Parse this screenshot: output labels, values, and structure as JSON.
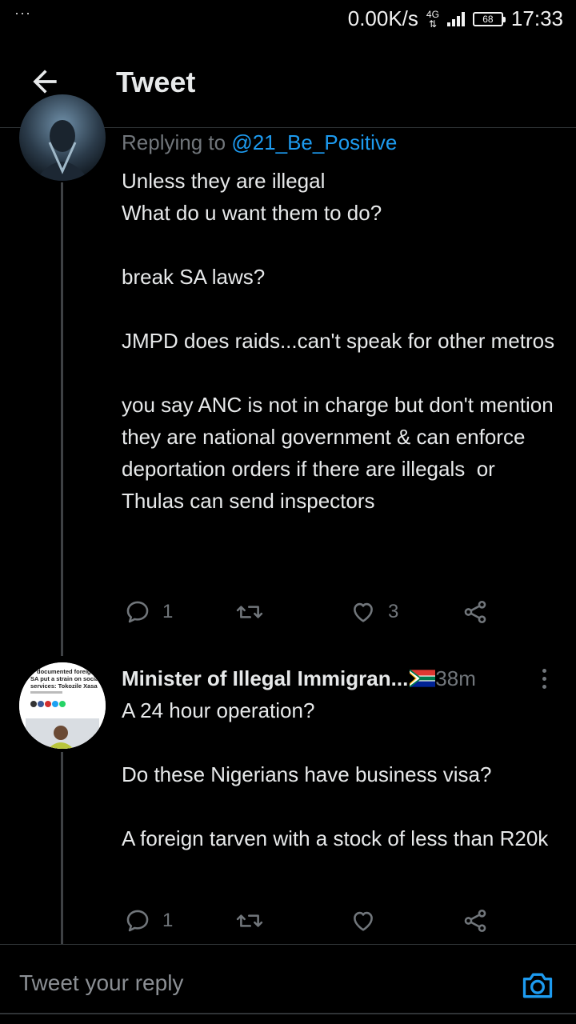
{
  "status_bar": {
    "dots": "···",
    "speed": "0.00K/s",
    "network": "4G",
    "battery": "68",
    "time": "17:33"
  },
  "header": {
    "back_icon": "arrow-left-icon",
    "title": "Tweet"
  },
  "tweet1": {
    "reply_prefix": "Replying to ",
    "reply_handle": "@21_Be_Positive",
    "text": "Unless they are illegal\nWhat do u want them to do?\n\nbreak SA laws?\n\nJMPD does raids...can't speak for other metros\n\nyou say ANC is not in charge but don't mention they are national government & can enforce deportation orders if there are illegals  or Thulas can send inspectors",
    "replies": "1",
    "retweets": "",
    "likes": "3"
  },
  "tweet2": {
    "display_name": "Minister of Illegal Immigran...",
    "time": "38m",
    "text": "A 24 hour operation?\n\nDo these Nigerians have business visa?\n\nA foreign tarven with a stock of less than R20k",
    "replies": "1",
    "retweets": "",
    "likes": "",
    "avatar_text": {
      "line1": "documented foreign",
      "line2": "SA put a strain on social",
      "line3": "services: Tokozile Xasa"
    }
  },
  "composer": {
    "placeholder": "Tweet your reply",
    "camera_icon": "camera-icon"
  },
  "colors": {
    "background": "#000000",
    "accent": "#1d9bf0",
    "muted": "#71767b",
    "text": "#e7e9ea"
  }
}
